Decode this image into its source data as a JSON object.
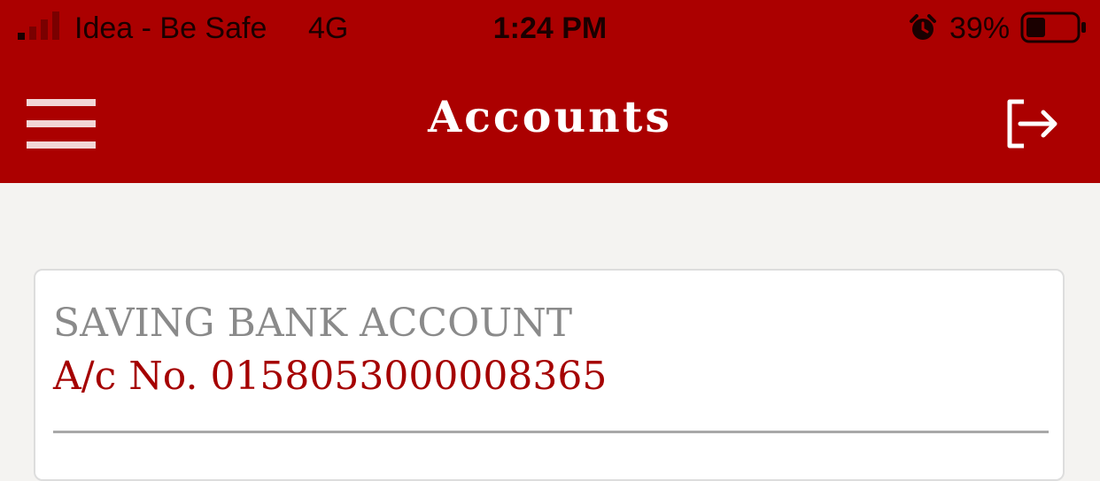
{
  "status_bar": {
    "carrier": "Idea - Be Safe",
    "network": "4G",
    "time": "1:24 PM",
    "battery_percent": "39%",
    "battery_level": 0.39,
    "signal_bars_active": 1,
    "signal_bars_total": 4,
    "icons": {
      "signal": "signal-strength-icon",
      "alarm": "alarm-clock-icon",
      "battery": "battery-icon"
    }
  },
  "header": {
    "title": "Accounts",
    "menu_icon": "hamburger-menu-icon",
    "logout_icon": "logout-icon"
  },
  "accounts": [
    {
      "type": "SAVING BANK ACCOUNT",
      "number_prefix": "A/c No.",
      "number": "0158053000008365"
    }
  ],
  "colors": {
    "brand_red": "#ab0000",
    "account_number_red": "#a50000",
    "label_gray": "#8a8a8a",
    "background": "#f4f3f1"
  }
}
